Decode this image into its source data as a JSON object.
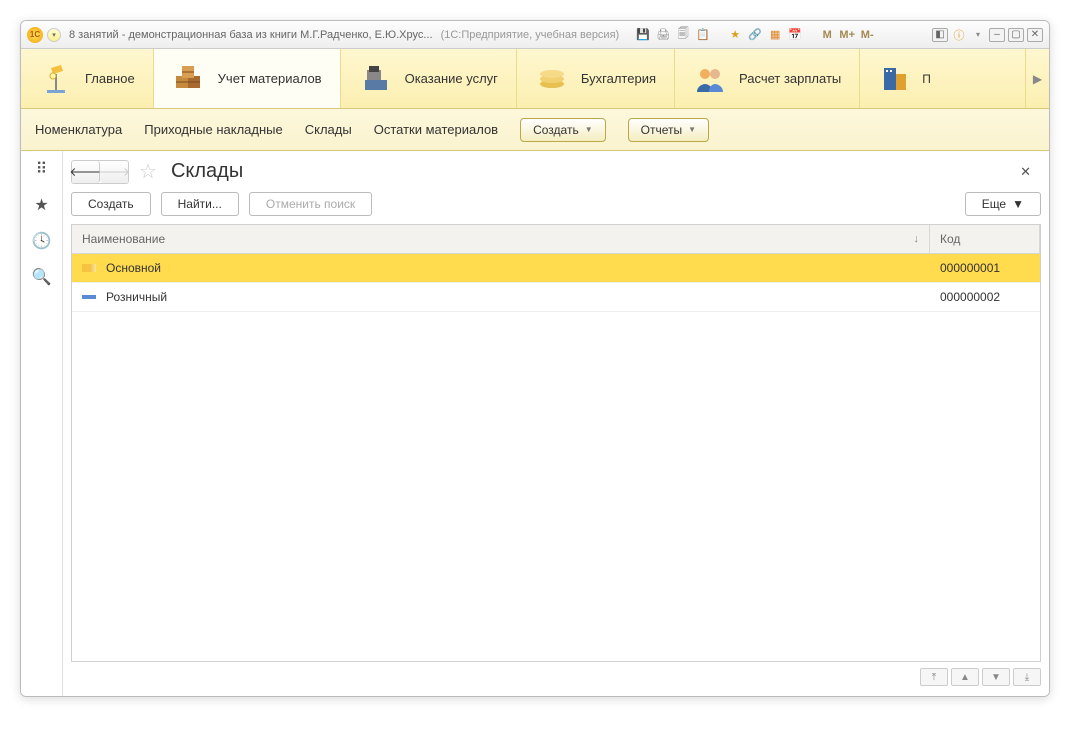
{
  "titlebar": {
    "logo": "1C",
    "title": "8 занятий - демонстрационная база из книги М.Г.Радченко, Е.Ю.Хрус...",
    "mode": "(1С:Предприятие, учебная версия)",
    "m": "M",
    "m_plus": "M+",
    "m_minus": "M-"
  },
  "ribbon": [
    {
      "label": "Главное",
      "icon": "home"
    },
    {
      "label": "Учет материалов",
      "icon": "boxes",
      "active": true
    },
    {
      "label": "Оказание услуг",
      "icon": "cashreg"
    },
    {
      "label": "Бухгалтерия",
      "icon": "coins"
    },
    {
      "label": "Расчет зарплаты",
      "icon": "people"
    },
    {
      "label": "П",
      "icon": "building",
      "cut": true
    }
  ],
  "subbar": {
    "links": [
      "Номенклатура",
      "Приходные накладные",
      "Склады",
      "Остатки материалов"
    ],
    "create": "Создать",
    "reports": "Отчеты"
  },
  "page": {
    "title": "Склады",
    "toolbar": {
      "create": "Создать",
      "find": "Найти...",
      "cancel": "Отменить поиск",
      "more": "Еще"
    },
    "columns": {
      "name": "Наименование",
      "code": "Код"
    },
    "rows": [
      {
        "name": "Основной",
        "code": "000000001",
        "selected": true,
        "icon": "gold"
      },
      {
        "name": "Розничный",
        "code": "000000002",
        "selected": false,
        "icon": "blue"
      }
    ]
  }
}
